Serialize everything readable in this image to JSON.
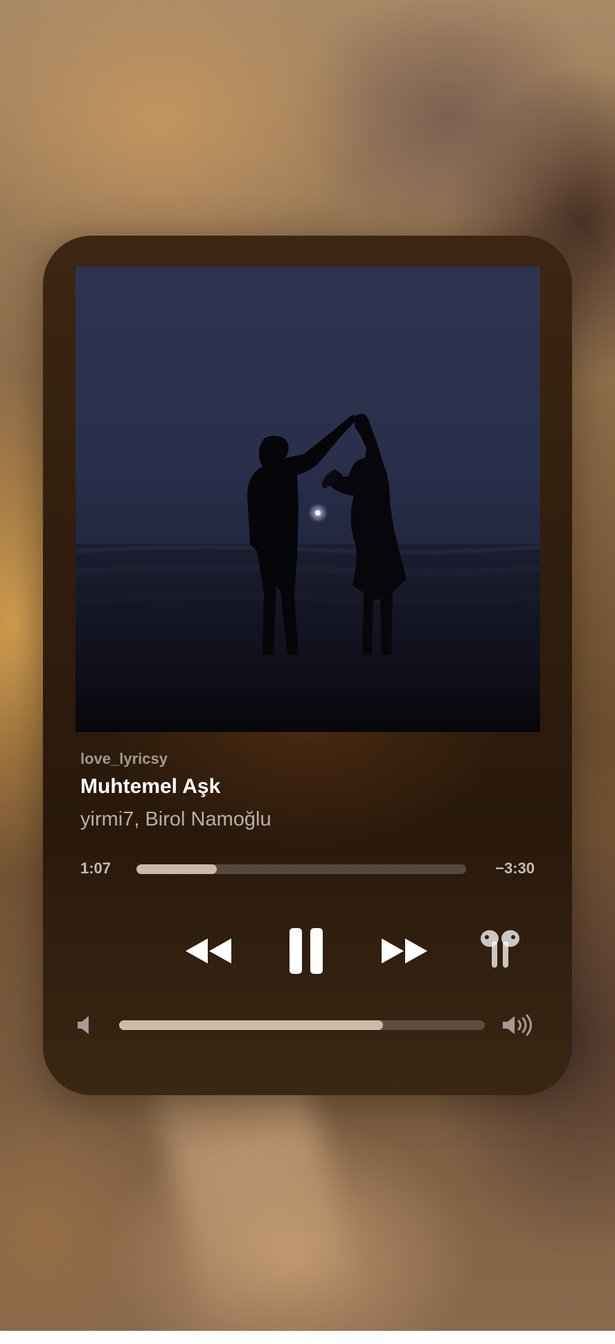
{
  "now_playing": {
    "source": "love_lyricsy",
    "title": "Muhtemel Aşk",
    "artist": "yirmi7, Birol Namoğlu"
  },
  "progress": {
    "elapsed": "1:07",
    "remaining": "−3:30",
    "fraction": 0.244
  },
  "controls": {
    "rewind_icon": "rewind-icon",
    "play_pause_icon": "pause-icon",
    "forward_icon": "fast-forward-icon",
    "output_icon": "airpods-icon"
  },
  "volume": {
    "fraction": 0.722,
    "low_icon": "speaker-low-icon",
    "high_icon": "speaker-high-icon"
  },
  "colors": {
    "accent": "#e1cdbe",
    "card": "#2f1d0d"
  }
}
